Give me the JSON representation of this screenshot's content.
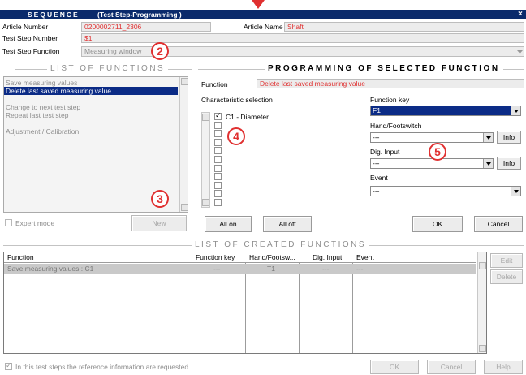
{
  "window": {
    "title_main": "SEQUENCE",
    "title_sub": "(Test Step-Programming )",
    "close_glyph": "×"
  },
  "header": {
    "article_number_label": "Article Number",
    "article_number_value": "0200002711_2306",
    "article_name_label": "Article Name",
    "article_name_value": "Shaft",
    "test_step_number_label": "Test Step Number",
    "test_step_number_value": "$1",
    "test_step_function_label": "Test Step Function",
    "test_step_function_value": "Measuring window"
  },
  "list_of_functions": {
    "title": "LIST OF FUNCTIONS",
    "items": [
      "Save measuring values",
      "Delete last saved measuring value",
      "",
      "Change to next test step",
      "Repeat last test step",
      "",
      "Adjustment / Calibration"
    ],
    "selected_index": 1,
    "expert_mode_label": "Expert mode",
    "new_button": "New"
  },
  "programming": {
    "title": "PROGRAMMING OF SELECTED FUNCTION",
    "function_label": "Function",
    "function_value": "Delete last saved measuring value",
    "characteristic_label": "Characteristic selection",
    "characteristics": [
      {
        "label": "C1 - Diameter",
        "checked": true
      },
      {
        "label": "",
        "checked": false
      },
      {
        "label": "",
        "checked": false
      },
      {
        "label": "",
        "checked": false
      },
      {
        "label": "",
        "checked": false
      },
      {
        "label": "",
        "checked": false
      },
      {
        "label": "",
        "checked": false
      },
      {
        "label": "",
        "checked": false
      },
      {
        "label": "",
        "checked": false
      },
      {
        "label": "",
        "checked": false
      },
      {
        "label": "",
        "checked": false
      }
    ],
    "function_key_label": "Function key",
    "function_key_value": "F1",
    "hand_footswitch_label": "Hand/Footswitch",
    "hand_footswitch_value": "---",
    "dig_input_label": "Dig. Input",
    "dig_input_value": "---",
    "event_label": "Event",
    "event_value": "---",
    "info_button": "Info",
    "all_on_button": "All on",
    "all_off_button": "All off",
    "ok_button": "OK",
    "cancel_button": "Cancel"
  },
  "created_functions": {
    "title": "LIST OF CREATED FUNCTIONS",
    "columns": [
      "Function",
      "Function key",
      "Hand/Footsw...",
      "Dig. Input",
      "Event"
    ],
    "rows": [
      [
        "Save measuring values : C1",
        "---",
        "T1",
        "---",
        "---"
      ]
    ],
    "edit_button": "Edit",
    "delete_button": "Delete"
  },
  "footer": {
    "reference_info_label": "In this test steps the reference information are requested",
    "ok_button": "OK",
    "cancel_button": "Cancel",
    "help_button": "Help"
  },
  "annotations": {
    "badge_2": "2",
    "badge_3": "3",
    "badge_4": "4",
    "badge_5": "5"
  },
  "colors": {
    "title_bar": "#0a2a6b",
    "accent_red": "#e03030",
    "selection": "#0b2b86",
    "row_highlight": "#c9c9c9"
  }
}
